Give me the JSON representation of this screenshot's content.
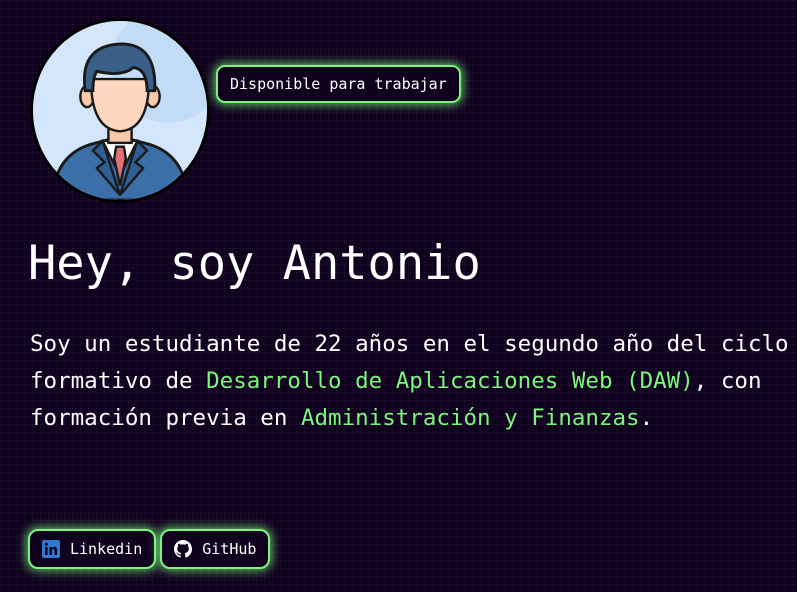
{
  "profile": {
    "status_badge": "Disponible para trabajar",
    "heading": "Hey, soy Antonio"
  },
  "bio": {
    "part1": "Soy un estudiante de 22 años en el segundo año del ciclo formativo de ",
    "highlight1": "Desarrollo de Aplicaciones Web (DAW)",
    "part2": ", con formación previa en ",
    "highlight2": "Administración y Finanzas",
    "part3": "."
  },
  "socials": [
    {
      "label": "Linkedin",
      "icon": "linkedin-icon"
    },
    {
      "label": "GitHub",
      "icon": "github-icon"
    }
  ],
  "colors": {
    "background": "#10011f",
    "accent": "#7af77a",
    "text": "#ffffff"
  }
}
